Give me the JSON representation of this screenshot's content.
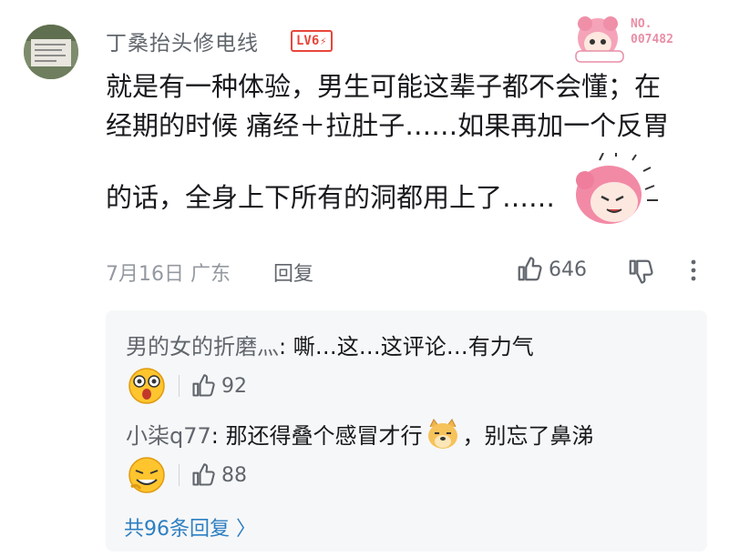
{
  "comment": {
    "username": "丁桑抬头修电线",
    "level": "LV6",
    "decoration_no_label": "NO.",
    "decoration_no": "007482",
    "text_lines": [
      "就是有一种体验，男生可能这辈子都不会懂；在",
      "经期的时候 痛经＋拉肚子……如果再加一个反胃",
      "的话，全身上下所有的洞都用上了……"
    ],
    "date": "7月16日",
    "location": "广东",
    "reply_label": "回复",
    "like_count": "646",
    "icons": [
      "thumb-up-icon",
      "thumb-down-icon",
      "more-vertical-icon"
    ]
  },
  "replies": [
    {
      "name": "男的女的折磨灬",
      "text": ": 嘶…这…这评论…有力气",
      "likes": "92",
      "emoji": "surprised-emoji-icon"
    },
    {
      "name": "小柒q77",
      "text_before": ": 那还得叠个感冒才行",
      "text_after": "，别忘了鼻涕",
      "likes": "88",
      "emoji": "laughing-emoji-icon",
      "inline_emoji": "doge-emoji-icon"
    }
  ],
  "total_replies": "共96条回复 〉",
  "colors": {
    "accent": "#2d7fc2",
    "level": "#e8463c",
    "muted": "#9499a0"
  }
}
